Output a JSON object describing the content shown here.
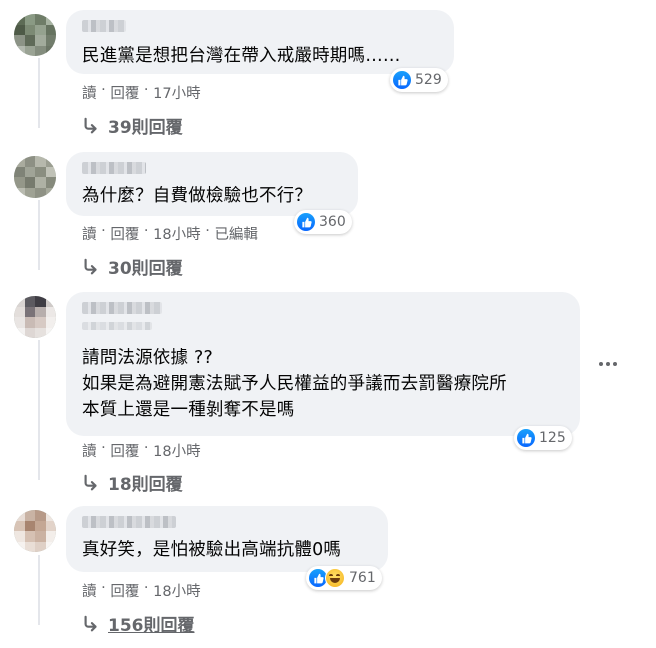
{
  "comments": [
    {
      "text": "民進黨是想把台灣在帶入戒嚴時期嗎……",
      "reactions": "529",
      "read": "讀",
      "reply": "回覆",
      "time": "17小時",
      "edited": "",
      "replies": "39則回覆"
    },
    {
      "text": "為什麼？自費做檢驗也不行？",
      "reactions": "360",
      "read": "讀",
      "reply": "回覆",
      "time": "18小時",
      "edited": "已編輯",
      "replies": "30則回覆"
    },
    {
      "text_lines": [
        "請問法源依據 ??",
        "如果是為避開憲法賦予人民權益的爭議而去罰醫療院所",
        "本質上還是一種剝奪不是嗎"
      ],
      "reactions": "125",
      "read": "讀",
      "reply": "回覆",
      "time": "18小時",
      "edited": "",
      "replies": "18則回覆"
    },
    {
      "text": "真好笑，是怕被驗出高端抗體0嗎",
      "reactions": "761",
      "read": "讀",
      "reply": "回覆",
      "time": "18小時",
      "edited": "",
      "replies": "156則回覆"
    }
  ],
  "separator": " · ",
  "icons": {
    "like": "like-icon",
    "haha": "haha-icon",
    "reply_arrow": "reply-arrow-icon",
    "more": "more-options-icon"
  },
  "colors": {
    "bubble": "#f0f2f5",
    "meta": "#65676b",
    "like_blue": "#0866ff"
  }
}
